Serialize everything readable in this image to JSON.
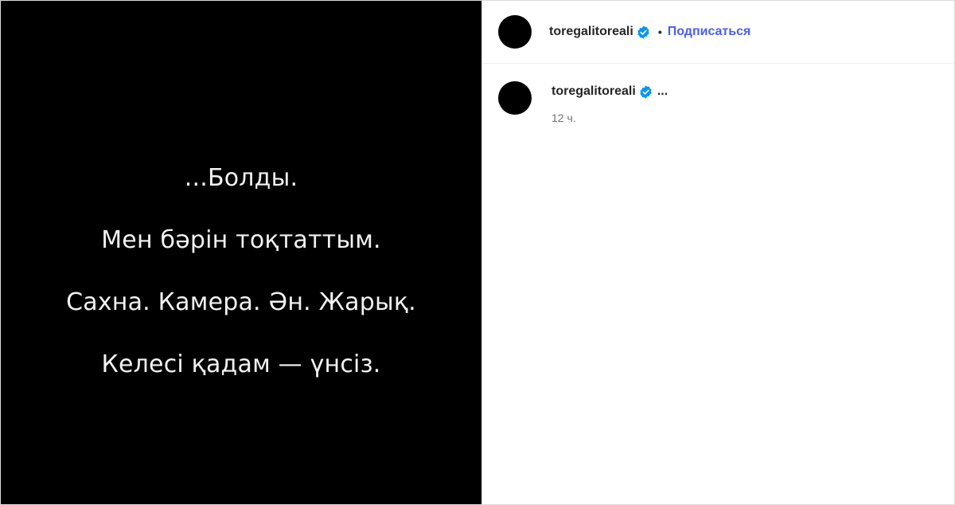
{
  "post": {
    "media_lines": [
      "...Болды.",
      "Мен бәрін тоқтаттым.",
      "Сахна. Камера. Ән. Жарық.",
      "Келесі қадам — үнсіз."
    ]
  },
  "header": {
    "username": "toregalitoreali",
    "separator": "•",
    "follow_label": "Подписаться"
  },
  "caption": {
    "username": "toregalitoreali",
    "text": "...",
    "time": "12 ч."
  },
  "colors": {
    "verified": "#0095f6",
    "follow": "#4a5df9"
  },
  "icons": {
    "verified": "verified-badge-icon"
  }
}
